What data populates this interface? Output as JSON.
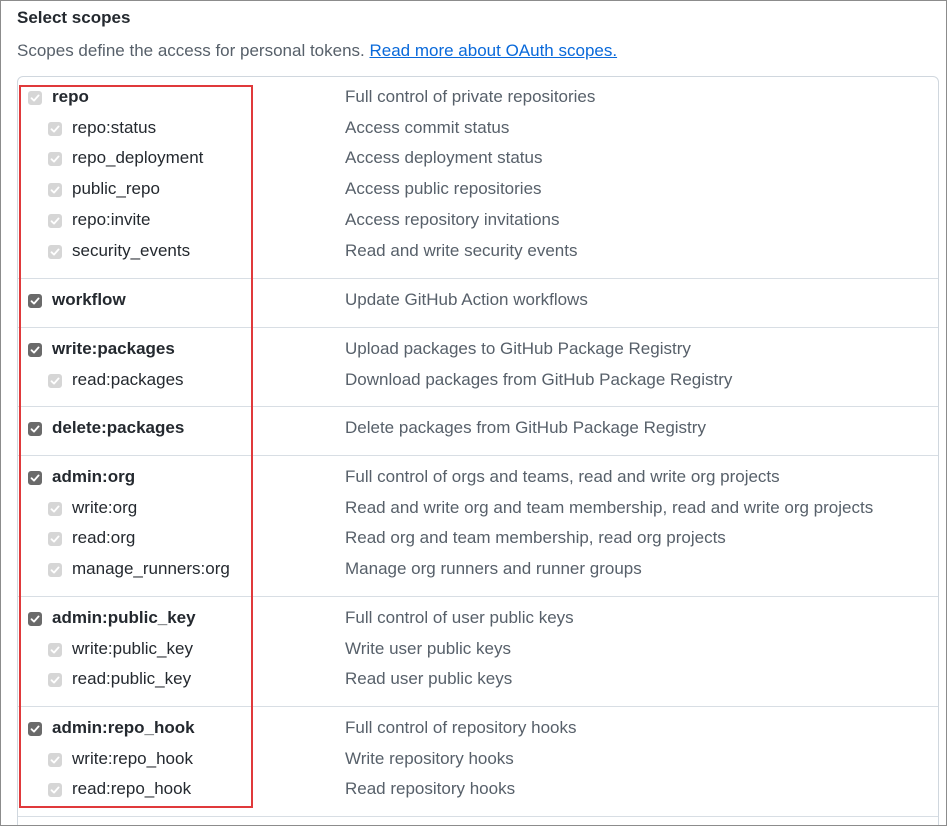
{
  "heading": "Select scopes",
  "intro": {
    "text": "Scopes define the access for personal tokens. ",
    "link": "Read more about OAuth scopes."
  },
  "groups": [
    {
      "name": "repo",
      "desc": "Full control of private repositories",
      "checked": true,
      "disabled": true,
      "children": [
        {
          "name": "repo:status",
          "desc": "Access commit status"
        },
        {
          "name": "repo_deployment",
          "desc": "Access deployment status"
        },
        {
          "name": "public_repo",
          "desc": "Access public repositories"
        },
        {
          "name": "repo:invite",
          "desc": "Access repository invitations"
        },
        {
          "name": "security_events",
          "desc": "Read and write security events"
        }
      ]
    },
    {
      "name": "workflow",
      "desc": "Update GitHub Action workflows",
      "checked": true,
      "disabled": false,
      "children": []
    },
    {
      "name": "write:packages",
      "desc": "Upload packages to GitHub Package Registry",
      "checked": true,
      "disabled": false,
      "children": [
        {
          "name": "read:packages",
          "desc": "Download packages from GitHub Package Registry"
        }
      ]
    },
    {
      "name": "delete:packages",
      "desc": "Delete packages from GitHub Package Registry",
      "checked": true,
      "disabled": false,
      "children": []
    },
    {
      "name": "admin:org",
      "desc": "Full control of orgs and teams, read and write org projects",
      "checked": true,
      "disabled": false,
      "children": [
        {
          "name": "write:org",
          "desc": "Read and write org and team membership, read and write org projects"
        },
        {
          "name": "read:org",
          "desc": "Read org and team membership, read org projects"
        },
        {
          "name": "manage_runners:org",
          "desc": "Manage org runners and runner groups"
        }
      ]
    },
    {
      "name": "admin:public_key",
      "desc": "Full control of user public keys",
      "checked": true,
      "disabled": false,
      "children": [
        {
          "name": "write:public_key",
          "desc": "Write user public keys"
        },
        {
          "name": "read:public_key",
          "desc": "Read user public keys"
        }
      ]
    },
    {
      "name": "admin:repo_hook",
      "desc": "Full control of repository hooks",
      "checked": true,
      "disabled": false,
      "children": [
        {
          "name": "write:repo_hook",
          "desc": "Write repository hooks"
        },
        {
          "name": "read:repo_hook",
          "desc": "Read repository hooks"
        }
      ]
    }
  ]
}
